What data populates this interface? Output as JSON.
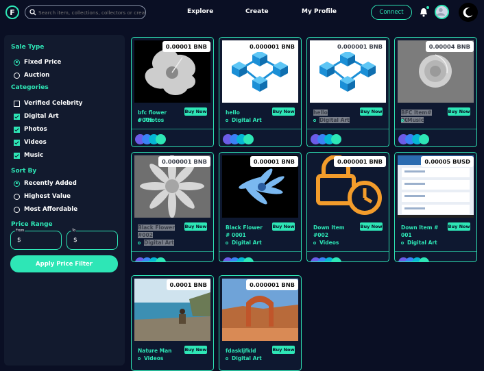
{
  "header": {
    "logo_letter": "F",
    "search_placeholder": "Search item, collections, collectors or creators",
    "nav": [
      "Explore",
      "Create",
      "My Profile"
    ],
    "connect_label": "Connect"
  },
  "sidebar": {
    "sale_type_title": "Sale Type",
    "sale_types": [
      {
        "label": "Fixed Price",
        "selected": true
      },
      {
        "label": "Auction",
        "selected": false
      }
    ],
    "categories_title": "Categories",
    "categories": [
      {
        "label": "Verified Celebrity",
        "checked": false
      },
      {
        "label": "Digital Art",
        "checked": true
      },
      {
        "label": "Photos",
        "checked": true
      },
      {
        "label": "Videos",
        "checked": true
      },
      {
        "label": "Music",
        "checked": true
      }
    ],
    "sort_title": "Sort By",
    "sort_options": [
      {
        "label": "Recently Added",
        "selected": true
      },
      {
        "label": "Highest Value",
        "selected": false
      },
      {
        "label": "Most Affordable",
        "selected": false
      }
    ],
    "price_range_title": "Price Range",
    "from_label": "From",
    "to_label": "To",
    "currency_symbol": "$",
    "apply_label": "Apply Price Filter"
  },
  "cards": [
    {
      "price": "0.00001 BNB",
      "name": "bfc flower #005",
      "category": "Photos",
      "buy": "Buy Now",
      "image": "white-flower"
    },
    {
      "price": "0.000001 BNB",
      "name": "hello",
      "category": "Digital Art",
      "buy": "Buy Now",
      "image": "blockchain-cubes"
    },
    {
      "price": "0.000001 BNB",
      "name": "hello",
      "category": "Digital Art",
      "buy": "Buy Now",
      "image": "blockchain-cubes"
    },
    {
      "price": "0.00004 BNB",
      "name": "BFC Item# 003",
      "category": "Music",
      "buy": "Buy Now",
      "image": "grey-rose"
    },
    {
      "price": "0.000001 BNB",
      "name": "Black Flower #002",
      "category": "Digital Art",
      "buy": "Buy Now",
      "image": "succulent"
    },
    {
      "price": "0.00001 BNB",
      "name": "Black Flower # 0001",
      "category": "Digital Art",
      "buy": "Buy Now",
      "image": "blue-flower"
    },
    {
      "price": "0.000001 BNB",
      "name": "Down Item #002",
      "category": "Videos",
      "buy": "Buy Now",
      "image": "lock-clock-icon"
    },
    {
      "price": "0.00005 BUSD",
      "name": "Down Item # 001",
      "category": "Digital Art",
      "buy": "Buy Now",
      "image": "app-screenshot"
    },
    {
      "price": "0.0001 BNB",
      "name": "Nature Man",
      "category": "Videos",
      "buy": "Buy Now",
      "image": "coast-man"
    },
    {
      "price": "0.000001 BNB",
      "name": "fdaskljfkld",
      "category": "Digital Art",
      "buy": "Buy Now",
      "image": "arch-landscape"
    }
  ],
  "colors": {
    "accent": "#2ee6b6",
    "background": "#0a0f24",
    "panel": "#121a2e"
  }
}
